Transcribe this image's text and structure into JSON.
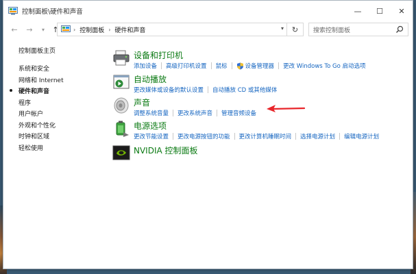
{
  "window": {
    "title": "控制面板\\硬件和声音",
    "controls": [
      "—",
      "☐",
      "✕"
    ]
  },
  "address": {
    "crumbs": [
      "控制面板",
      "硬件和声音"
    ],
    "search_placeholder": "搜索控制面板"
  },
  "leftnav": {
    "home": "控制面板主页",
    "items": [
      {
        "label": "系统和安全",
        "active": false
      },
      {
        "label": "网络和 Internet",
        "active": false
      },
      {
        "label": "硬件和声音",
        "active": true
      },
      {
        "label": "程序",
        "active": false
      },
      {
        "label": "用户帐户",
        "active": false
      },
      {
        "label": "外观和个性化",
        "active": false
      },
      {
        "label": "时钟和区域",
        "active": false
      },
      {
        "label": "轻松使用",
        "active": false
      }
    ]
  },
  "categories": [
    {
      "title": "设备和打印机",
      "icon": "printer-icon",
      "links": [
        "添加设备",
        "高级打印机设置",
        "鼠标",
        "设备管理器",
        "更改 Windows To Go 启动选项"
      ]
    },
    {
      "title": "自动播放",
      "icon": "autoplay-icon",
      "links": [
        "更改媒体或设备的默认设置",
        "自动播放 CD 或其他媒体"
      ]
    },
    {
      "title": "声音",
      "icon": "speaker-icon",
      "links": [
        "调整系统音量",
        "更改系统声音",
        "管理音频设备"
      ]
    },
    {
      "title": "电源选项",
      "icon": "power-options-icon",
      "links": [
        "更改节能设置",
        "更改电源按钮的功能",
        "更改计算机睡眠时间",
        "选择电源计划",
        "编辑电源计划"
      ]
    },
    {
      "title": "NVIDIA 控制面板",
      "icon": "nvidia-icon",
      "links": []
    }
  ],
  "colors": {
    "link": "#1565c0",
    "category_title": "#0b7a13",
    "annotation_arrow": "#e8252a"
  }
}
